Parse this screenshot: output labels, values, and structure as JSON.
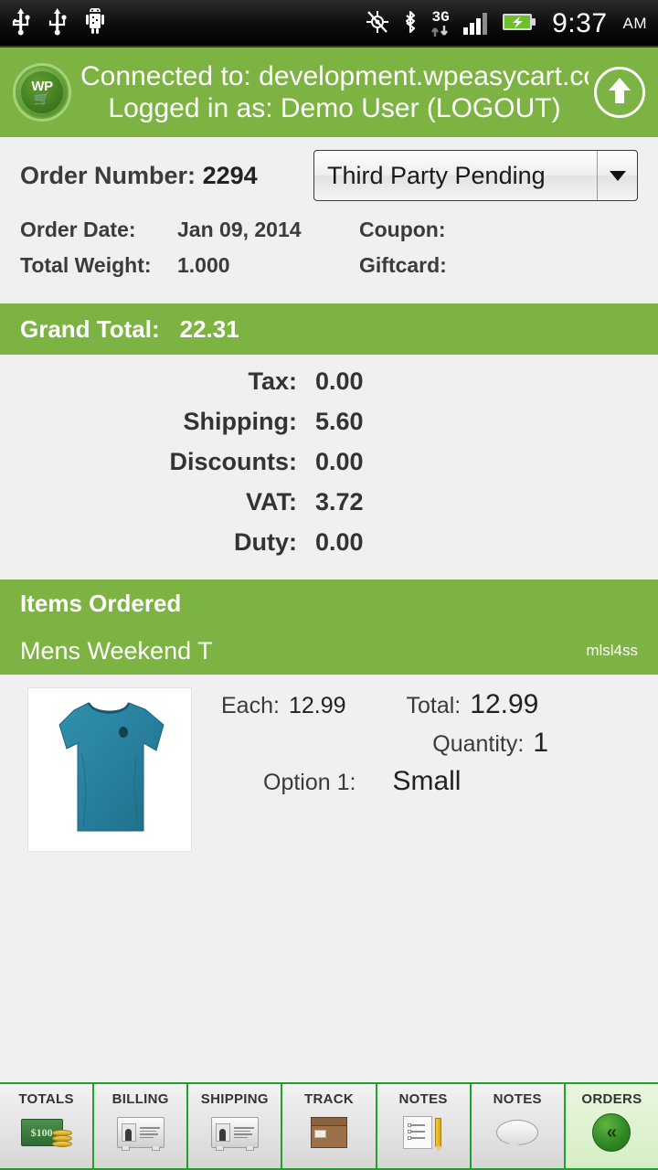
{
  "statusbar": {
    "time": "9:37",
    "ampm": "AM",
    "network_label": "3G",
    "icons": [
      "usb-icon",
      "usb-icon",
      "android-robot-icon",
      "gps-off-icon",
      "bluetooth-icon",
      "3g-data-icon",
      "signal-bars-icon",
      "battery-charging-icon"
    ]
  },
  "header": {
    "logo_text": "WP",
    "connected_line": "Connected to: development.wpeasycart.cc",
    "logged_in_line": "Logged in as: Demo User  (LOGOUT)",
    "up_button": "scroll-to-top",
    "bg_color": "#7cb342"
  },
  "order": {
    "number_label": "Order Number:",
    "number_value": "2294",
    "status_selected": "Third Party Pending",
    "date_label": "Order Date:",
    "date_value": "Jan  09, 2014",
    "weight_label": "Total Weight:",
    "weight_value": "1.000",
    "coupon_label": "Coupon:",
    "coupon_value": "",
    "giftcard_label": "Giftcard:",
    "giftcard_value": ""
  },
  "totals": {
    "grand_total_label": "Grand Total:",
    "grand_total_value": "22.31",
    "rows": [
      {
        "label": "Tax:",
        "value": "0.00"
      },
      {
        "label": "Shipping:",
        "value": "5.60"
      },
      {
        "label": "Discounts:",
        "value": "0.00"
      },
      {
        "label": "VAT:",
        "value": "3.72"
      },
      {
        "label": "Duty:",
        "value": "0.00"
      }
    ]
  },
  "items": {
    "section_title": "Items Ordered",
    "product": {
      "name": "Mens Weekend T",
      "sku": "mlsl4ss",
      "each_label": "Each:",
      "each_value": "12.99",
      "total_label": "Total:",
      "total_value": "12.99",
      "quantity_label": "Quantity:",
      "quantity_value": "1",
      "option1_label": "Option 1:",
      "option1_value": "Small",
      "image_alt": "teal-tshirt-thumbnail",
      "shirt_color": "#2a7f9e"
    }
  },
  "tabbar": {
    "tabs": [
      {
        "label": "TOTALS",
        "icon": "money-icon",
        "active": false,
        "bill_text": "$100"
      },
      {
        "label": "BILLING",
        "icon": "address-card-icon",
        "active": false
      },
      {
        "label": "SHIPPING",
        "icon": "address-card-icon",
        "active": false
      },
      {
        "label": "TRACK",
        "icon": "package-box-icon",
        "active": false
      },
      {
        "label": "NOTES",
        "icon": "notepad-pencil-icon",
        "active": false
      },
      {
        "label": "NOTES",
        "icon": "speech-bubble-icon",
        "active": false
      },
      {
        "label": "ORDERS",
        "icon": "back-chevrons-icon",
        "active": true,
        "glyph": "«"
      }
    ],
    "border_color": "#22a12a"
  }
}
